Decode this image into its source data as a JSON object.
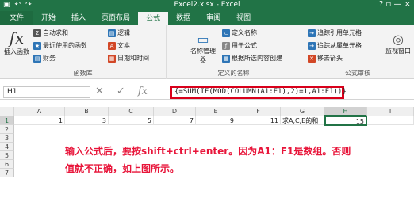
{
  "window": {
    "title": "Excel2.xlsx - Excel",
    "controls": "? ▫ — ×"
  },
  "qat": {
    "undo": "↶",
    "redo": "↷"
  },
  "tabs": [
    "文件",
    "开始",
    "插入",
    "页面布局",
    "公式",
    "数据",
    "审阅",
    "视图"
  ],
  "ribbon": {
    "insert_function": {
      "icon": "fx",
      "label": "插入函数"
    },
    "group1": {
      "name": "函数库",
      "items": [
        "自动求和",
        "最近使用的函数",
        "财务",
        "逻辑",
        "文本",
        "日期和时间"
      ]
    },
    "group2": {
      "name": "定义的名称",
      "name_manager": "名称管理器",
      "items": [
        "定义名称",
        "用于公式",
        "根据所选内容创建"
      ]
    },
    "group3": {
      "name": "公式审核",
      "items": [
        "追踪引用单元格",
        "追踪从属单元格",
        "移去箭头"
      ],
      "watch": "监视窗口"
    }
  },
  "formula_bar": {
    "name_box": "H1",
    "cancel": "✕",
    "enter": "✓",
    "fx": "fx",
    "formula": "{=SUM(IF(MOD(COLUMN(A1:F1),2)=1,A1:F1))}"
  },
  "columns": [
    "A",
    "B",
    "C",
    "D",
    "E",
    "F",
    "G",
    "H",
    "I"
  ],
  "rows": [
    "1",
    "2",
    "3",
    "4",
    "5",
    "6",
    "7"
  ],
  "row1": [
    "1",
    "3",
    "5",
    "7",
    "9",
    "11",
    "求A,C,E的和",
    "15"
  ],
  "note": "输入公式后，要按shift+ctrl+enter。因为A1：F1是数组。否则值就不正确，如上图所示。"
}
